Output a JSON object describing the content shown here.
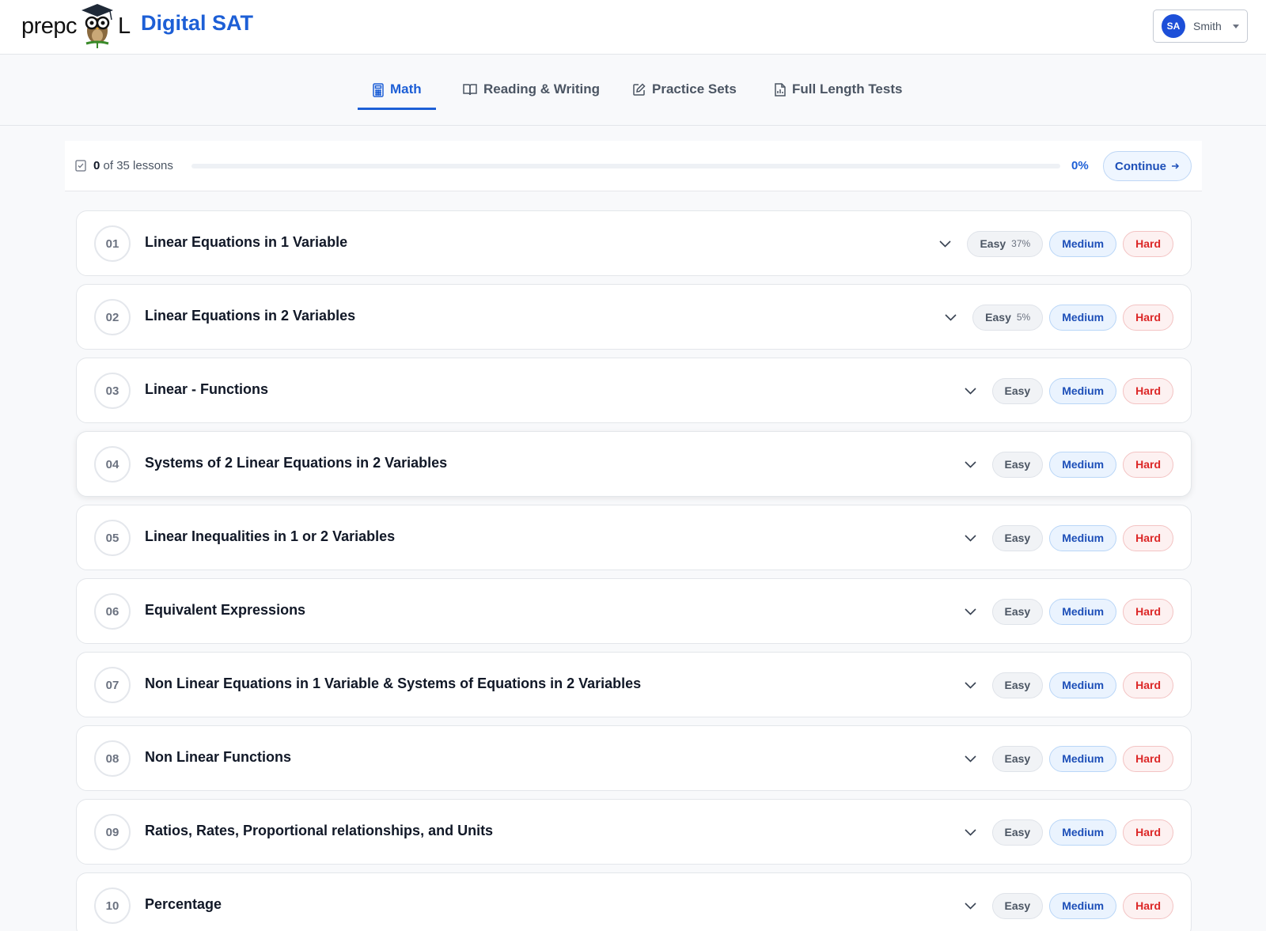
{
  "header": {
    "logo_text_left": "prepc",
    "logo_text_right": "L",
    "app_title": "Digital SAT",
    "user": {
      "initials": "SA",
      "name": "Smith"
    }
  },
  "tabs": [
    {
      "label": "Math",
      "icon": "calculator-icon",
      "active": true
    },
    {
      "label": "Reading & Writing",
      "icon": "book-icon",
      "active": false
    },
    {
      "label": "Practice Sets",
      "icon": "edit-icon",
      "active": false
    },
    {
      "label": "Full Length Tests",
      "icon": "document-chart-icon",
      "active": false
    }
  ],
  "progress": {
    "completed": "0",
    "of_text": "of 35 lessons",
    "percent_label": "0%",
    "fraction": 0,
    "continue_label": "Continue"
  },
  "lessons": [
    {
      "num": "01",
      "title": "Linear Equations in 1 Variable",
      "easy": "Easy",
      "easy_pct": "37%",
      "medium": "Medium",
      "hard": "Hard"
    },
    {
      "num": "02",
      "title": "Linear Equations in 2 Variables",
      "easy": "Easy",
      "easy_pct": "5%",
      "medium": "Medium",
      "hard": "Hard"
    },
    {
      "num": "03",
      "title": "Linear - Functions",
      "easy": "Easy",
      "easy_pct": "",
      "medium": "Medium",
      "hard": "Hard"
    },
    {
      "num": "04",
      "title": "Systems of 2 Linear Equations in 2 Variables",
      "easy": "Easy",
      "easy_pct": "",
      "medium": "Medium",
      "hard": "Hard"
    },
    {
      "num": "05",
      "title": "Linear Inequalities in 1 or 2 Variables",
      "easy": "Easy",
      "easy_pct": "",
      "medium": "Medium",
      "hard": "Hard"
    },
    {
      "num": "06",
      "title": "Equivalent Expressions",
      "easy": "Easy",
      "easy_pct": "",
      "medium": "Medium",
      "hard": "Hard"
    },
    {
      "num": "07",
      "title": "Non Linear Equations in 1 Variable & Systems of Equations in 2 Variables",
      "easy": "Easy",
      "easy_pct": "",
      "medium": "Medium",
      "hard": "Hard"
    },
    {
      "num": "08",
      "title": "Non Linear Functions",
      "easy": "Easy",
      "easy_pct": "",
      "medium": "Medium",
      "hard": "Hard"
    },
    {
      "num": "09",
      "title": "Ratios, Rates, Proportional relationships, and Units",
      "easy": "Easy",
      "easy_pct": "",
      "medium": "Medium",
      "hard": "Hard"
    },
    {
      "num": "10",
      "title": "Percentage",
      "easy": "Easy",
      "easy_pct": "",
      "medium": "Medium",
      "hard": "Hard"
    }
  ],
  "colors": {
    "accent": "#1d5fd6",
    "hard": "#dc2626",
    "medium": "#1d4fb8"
  }
}
